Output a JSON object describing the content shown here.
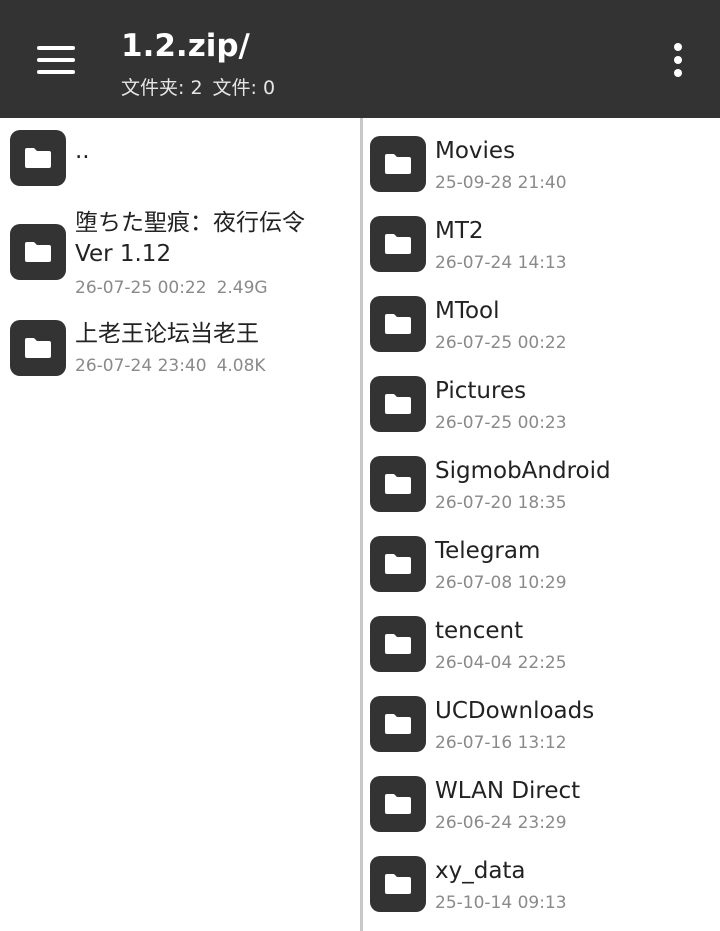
{
  "toolbar": {
    "title": "1.2.zip/",
    "folders_label": "文件夹: 2",
    "files_label": "文件: 0"
  },
  "left_pane": {
    "parent_dir": "..",
    "items": [
      {
        "name_line1": "堕ちた聖痕：夜行伝令",
        "name_line2": "Ver 1.12",
        "date": "26-07-25 00:22",
        "size": "2.49G"
      },
      {
        "name": "上老王论坛当老王",
        "date": "26-07-24 23:40",
        "size": "4.08K"
      }
    ]
  },
  "right_pane": {
    "items": [
      {
        "name": "Movies",
        "date": "25-09-28 21:40"
      },
      {
        "name": "MT2",
        "date": "26-07-24 14:13"
      },
      {
        "name": "MTool",
        "date": "26-07-25 00:22"
      },
      {
        "name": "Pictures",
        "date": "26-07-25 00:23"
      },
      {
        "name": "SigmobAndroid",
        "date": "26-07-20 18:35"
      },
      {
        "name": "Telegram",
        "date": "26-07-08 10:29"
      },
      {
        "name": "tencent",
        "date": "26-04-04 22:25"
      },
      {
        "name": "UCDownloads",
        "date": "26-07-16 13:12"
      },
      {
        "name": "WLAN Direct",
        "date": "26-06-24 23:29"
      },
      {
        "name": "xy_data",
        "date": "25-10-14 09:13"
      }
    ]
  },
  "icons": {
    "menu": "hamburger-menu-icon",
    "more": "more-vert-icon",
    "folder": "folder-icon"
  },
  "colors": {
    "toolbar_bg": "#333333",
    "icon_bg": "#333333",
    "text_primary": "#222222",
    "text_secondary": "#8a8a8a",
    "divider": "#c8c8c8"
  }
}
